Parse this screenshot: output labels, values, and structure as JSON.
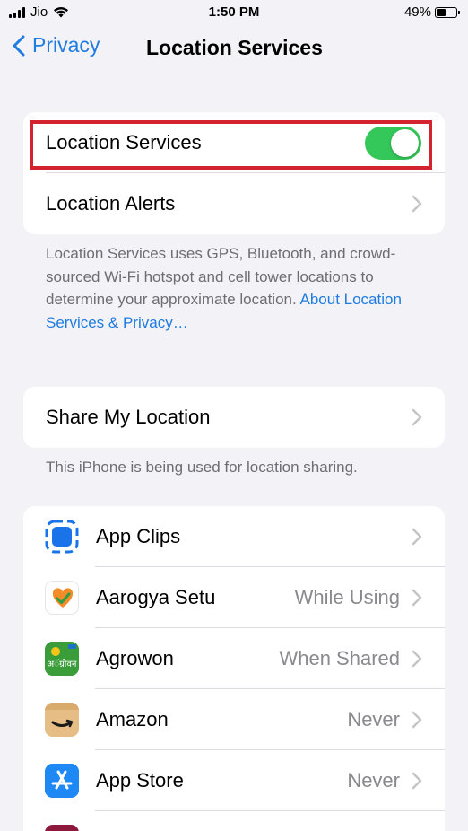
{
  "status_bar": {
    "carrier": "Jio",
    "time": "1:50 PM",
    "battery": "49%",
    "battery_level": 0.49
  },
  "nav": {
    "back_label": "Privacy",
    "title": "Location Services"
  },
  "group1": {
    "location_services_label": "Location Services",
    "location_services_on": true,
    "location_alerts_label": "Location Alerts"
  },
  "footnote1": {
    "text": "Location Services uses GPS, Bluetooth, and crowd-sourced Wi-Fi hotspot and cell tower locations to determine your approximate location.",
    "link": "About Location Services & Privacy…"
  },
  "group2": {
    "share_label": "Share My Location"
  },
  "footnote2": "This iPhone is being used for location sharing.",
  "apps": [
    {
      "name": "App Clips",
      "value": "",
      "icon": "app-clips-icon"
    },
    {
      "name": "Aarogya Setu",
      "value": "While Using",
      "icon": "aarogya-setu-icon"
    },
    {
      "name": "Agrowon",
      "value": "When Shared",
      "icon": "agrowon-icon",
      "icon_text": "अॅग्रोवन"
    },
    {
      "name": "Amazon",
      "value": "Never",
      "icon": "amazon-icon"
    },
    {
      "name": "App Store",
      "value": "Never",
      "icon": "app-store-icon"
    }
  ],
  "colors": {
    "accent": "#1f7ce0",
    "toggle_on": "#34c759",
    "highlight": "#d2232e"
  }
}
